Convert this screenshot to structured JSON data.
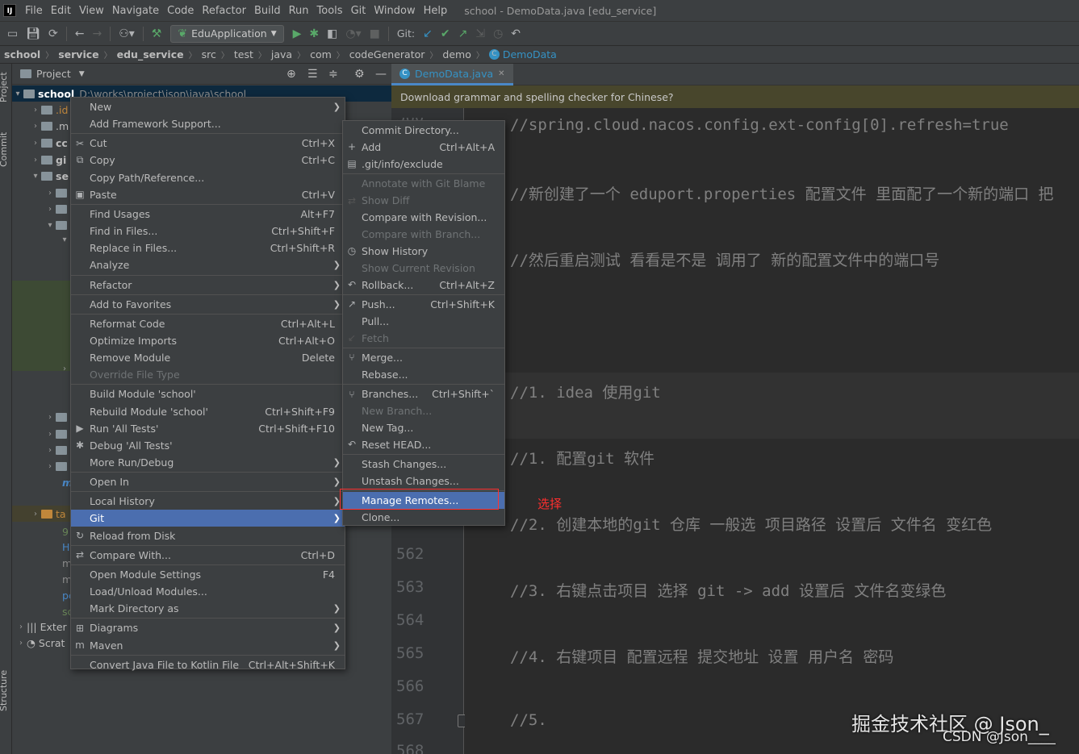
{
  "menubar": {
    "items": [
      "File",
      "Edit",
      "View",
      "Navigate",
      "Code",
      "Refactor",
      "Build",
      "Run",
      "Tools",
      "Git",
      "Window",
      "Help"
    ],
    "window_title": "school - DemoData.java [edu_service]"
  },
  "toolbar": {
    "run_config": "EduApplication",
    "git_label": "Git:"
  },
  "breadcrumb": [
    "school",
    "service",
    "edu_service",
    "src",
    "test",
    "java",
    "com",
    "codeGenerator",
    "demo",
    "DemoData"
  ],
  "left_stripe": {
    "project": "Project",
    "commit": "Commit",
    "structure": "Structure"
  },
  "project_panel": {
    "title": "Project",
    "root_name": "school",
    "root_path": "D:\\works\\project\\json\\java\\school",
    "row_fragments": [
      ".id",
      ".m",
      "cc",
      "gi",
      "se",
      "9",
      "Hl",
      "m",
      "m",
      "pc",
      "sc",
      "Exter",
      "Scrat",
      "m",
      "ta"
    ]
  },
  "editor": {
    "tab_label": "DemoData.java",
    "notice": "Download grammar and spelling checker for Chinese?",
    "code_lines": [
      {
        "num": "",
        "text": "//spring.cloud.nacos.config.ext-config[0].refresh=true"
      },
      {
        "num": "",
        "text": "//新创建了一个 eduport.properties 配置文件 里面配了一个新的端口 把"
      },
      {
        "num": "",
        "text": "//然后重启测试  看看是不是 调用了 新的配置文件中的端口号"
      },
      {
        "num": "",
        "text": "//1. idea 使用git"
      },
      {
        "num": "",
        "text": "//1. 配置git 软件"
      },
      {
        "num": "",
        "text": "//2. 创建本地的git 仓库 一般选 项目路径  设置后 文件名 变红色"
      },
      {
        "num": "563",
        "text": "//3. 右键点击项目 选择 git  -> add   设置后 文件名变绿色"
      },
      {
        "num": "565",
        "text": "//4. 右键项目 配置远程 提交地址 设置 用户名 密码"
      },
      {
        "num": "567",
        "text": "//5."
      }
    ],
    "gutter_numbers": [
      "562",
      "563",
      "564",
      "565",
      "566",
      "567",
      "568"
    ],
    "annotation": "选择"
  },
  "context_menu": [
    {
      "label": "New",
      "shortcut": "",
      "submenu": true,
      "icon": ""
    },
    {
      "label": "Add Framework Support...",
      "shortcut": "",
      "icon": ""
    },
    {
      "sep": true
    },
    {
      "label": "Cut",
      "shortcut": "Ctrl+X",
      "icon": "✂"
    },
    {
      "label": "Copy",
      "shortcut": "Ctrl+C",
      "icon": "⧉"
    },
    {
      "label": "Copy Path/Reference...",
      "shortcut": "",
      "icon": ""
    },
    {
      "label": "Paste",
      "shortcut": "Ctrl+V",
      "icon": "▣"
    },
    {
      "sep": true
    },
    {
      "label": "Find Usages",
      "shortcut": "Alt+F7",
      "icon": ""
    },
    {
      "label": "Find in Files...",
      "shortcut": "Ctrl+Shift+F",
      "icon": ""
    },
    {
      "label": "Replace in Files...",
      "shortcut": "Ctrl+Shift+R",
      "icon": ""
    },
    {
      "label": "Analyze",
      "shortcut": "",
      "submenu": true,
      "icon": ""
    },
    {
      "sep": true
    },
    {
      "label": "Refactor",
      "shortcut": "",
      "submenu": true,
      "icon": ""
    },
    {
      "sep": true
    },
    {
      "label": "Add to Favorites",
      "shortcut": "",
      "submenu": true,
      "icon": ""
    },
    {
      "sep": true
    },
    {
      "label": "Reformat Code",
      "shortcut": "Ctrl+Alt+L",
      "icon": ""
    },
    {
      "label": "Optimize Imports",
      "shortcut": "Ctrl+Alt+O",
      "icon": ""
    },
    {
      "label": "Remove Module",
      "shortcut": "Delete",
      "icon": ""
    },
    {
      "label": "Override File Type",
      "shortcut": "",
      "disabled": true,
      "icon": ""
    },
    {
      "sep": true
    },
    {
      "label": "Build Module 'school'",
      "shortcut": "",
      "icon": ""
    },
    {
      "label": "Rebuild Module 'school'",
      "shortcut": "Ctrl+Shift+F9",
      "icon": ""
    },
    {
      "label": "Run 'All Tests'",
      "shortcut": "Ctrl+Shift+F10",
      "icon": "▶"
    },
    {
      "label": "Debug 'All Tests'",
      "shortcut": "",
      "icon": "✱"
    },
    {
      "label": "More Run/Debug",
      "shortcut": "",
      "submenu": true,
      "icon": ""
    },
    {
      "sep": true
    },
    {
      "label": "Open In",
      "shortcut": "",
      "submenu": true,
      "icon": ""
    },
    {
      "sep": true
    },
    {
      "label": "Local History",
      "shortcut": "",
      "submenu": true,
      "icon": ""
    },
    {
      "label": "Git",
      "shortcut": "",
      "submenu": true,
      "selected": true,
      "icon": ""
    },
    {
      "label": "Reload from Disk",
      "shortcut": "",
      "icon": "↻"
    },
    {
      "sep": true
    },
    {
      "label": "Compare With...",
      "shortcut": "Ctrl+D",
      "icon": "⇄"
    },
    {
      "sep": true
    },
    {
      "label": "Open Module Settings",
      "shortcut": "F4",
      "icon": ""
    },
    {
      "label": "Load/Unload Modules...",
      "shortcut": "",
      "icon": ""
    },
    {
      "label": "Mark Directory as",
      "shortcut": "",
      "submenu": true,
      "icon": ""
    },
    {
      "sep": true
    },
    {
      "label": "Diagrams",
      "shortcut": "",
      "submenu": true,
      "icon": "⊞"
    },
    {
      "label": "Maven",
      "shortcut": "",
      "submenu": true,
      "icon": "m"
    },
    {
      "sep": true
    },
    {
      "label": "Convert Java File to Kotlin File",
      "shortcut": "Ctrl+Alt+Shift+K",
      "icon": ""
    }
  ],
  "git_submenu": [
    {
      "label": "Commit Directory...",
      "shortcut": "",
      "icon": ""
    },
    {
      "label": "Add",
      "shortcut": "Ctrl+Alt+A",
      "icon": "+"
    },
    {
      "label": ".git/info/exclude",
      "shortcut": "",
      "icon": "▤"
    },
    {
      "sep": true
    },
    {
      "label": "Annotate with Git Blame",
      "shortcut": "",
      "disabled": true,
      "icon": ""
    },
    {
      "label": "Show Diff",
      "shortcut": "",
      "disabled": true,
      "icon": "⇄"
    },
    {
      "label": "Compare with Revision...",
      "shortcut": "",
      "icon": ""
    },
    {
      "label": "Compare with Branch...",
      "shortcut": "",
      "disabled": true,
      "icon": ""
    },
    {
      "label": "Show History",
      "shortcut": "",
      "icon": "◷"
    },
    {
      "label": "Show Current Revision",
      "shortcut": "",
      "disabled": true,
      "icon": ""
    },
    {
      "label": "Rollback...",
      "shortcut": "Ctrl+Alt+Z",
      "icon": "↶"
    },
    {
      "sep": true
    },
    {
      "label": "Push...",
      "shortcut": "Ctrl+Shift+K",
      "icon": "↗"
    },
    {
      "label": "Pull...",
      "shortcut": "",
      "icon": ""
    },
    {
      "label": "Fetch",
      "shortcut": "",
      "disabled": true,
      "icon": "↙"
    },
    {
      "sep": true
    },
    {
      "label": "Merge...",
      "shortcut": "",
      "icon": "⑂"
    },
    {
      "label": "Rebase...",
      "shortcut": "",
      "icon": ""
    },
    {
      "sep": true
    },
    {
      "label": "Branches...",
      "shortcut": "Ctrl+Shift+`",
      "icon": "⑂"
    },
    {
      "label": "New Branch...",
      "shortcut": "",
      "disabled": true,
      "icon": ""
    },
    {
      "label": "New Tag...",
      "shortcut": "",
      "icon": ""
    },
    {
      "label": "Reset HEAD...",
      "shortcut": "",
      "icon": "↶"
    },
    {
      "sep": true
    },
    {
      "label": "Stash Changes...",
      "shortcut": "",
      "icon": ""
    },
    {
      "label": "Unstash Changes...",
      "shortcut": "",
      "icon": ""
    },
    {
      "sep": true
    },
    {
      "label": "Manage Remotes...",
      "shortcut": "",
      "selected": true,
      "icon": ""
    },
    {
      "label": "Clone...",
      "shortcut": "",
      "icon": ""
    }
  ],
  "watermark": {
    "line1": "掘金技术社区 @ Json_",
    "line2": "CSDN @Json____"
  },
  "colors": {
    "selection": "#4b6eaf",
    "panel": "#3c3f41",
    "editor": "#2b2b2b",
    "notice": "#48462c",
    "annotation": "#ff2e2e"
  }
}
